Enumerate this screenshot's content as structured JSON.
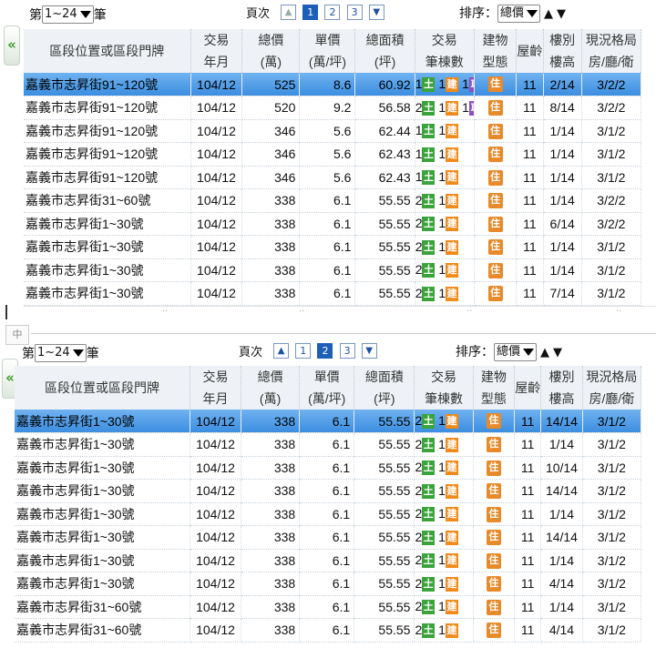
{
  "colors": {
    "selected_row": "#4a9be8",
    "land_badge": "#3aa33a",
    "building_badge": "#f08a1a",
    "car_badge": "#8f4fc0",
    "type_badge": "#e8892a"
  },
  "panels": [
    {
      "count_prefix": "第",
      "count_select": "1~24",
      "count_suffix": "筆",
      "pager_label": "頁次",
      "pages": [
        "1",
        "2",
        "3"
      ],
      "active_page": "1",
      "sort_label": "排序：",
      "sort_value": "總價",
      "headers": {
        "addr": "區段位置或區段門牌",
        "date": [
          "交易",
          "年月"
        ],
        "price": [
          "總價",
          "(萬)"
        ],
        "unit": [
          "單價",
          "(萬/坪)"
        ],
        "area": [
          "總面積",
          "(坪)"
        ],
        "deal": [
          "交易",
          "筆棟數"
        ],
        "btype": [
          "建物",
          "型態"
        ],
        "age": "屋齡",
        "floor": [
          "樓別",
          "樓高"
        ],
        "layout": [
          "現況格局",
          "房/廳/衛"
        ]
      },
      "rows": [
        {
          "addr": "嘉義市志昇街91~120號",
          "date": "104/12",
          "price": "525",
          "unit": "8.6",
          "area": "60.92",
          "land": "1",
          "bld": "1",
          "car": "1",
          "type": "住",
          "age": "11",
          "floor": "2/14",
          "layout": "3/2/2",
          "selected": true
        },
        {
          "addr": "嘉義市志昇街91~120號",
          "date": "104/12",
          "price": "520",
          "unit": "9.2",
          "area": "56.58",
          "land": "2",
          "bld": "1",
          "car": "1",
          "type": "住",
          "age": "11",
          "floor": "8/14",
          "layout": "3/2/2"
        },
        {
          "addr": "嘉義市志昇街91~120號",
          "date": "104/12",
          "price": "346",
          "unit": "5.6",
          "area": "62.44",
          "land": "1",
          "bld": "1",
          "car": "",
          "type": "住",
          "age": "11",
          "floor": "1/14",
          "layout": "3/1/2"
        },
        {
          "addr": "嘉義市志昇街91~120號",
          "date": "104/12",
          "price": "346",
          "unit": "5.6",
          "area": "62.43",
          "land": "1",
          "bld": "1",
          "car": "",
          "type": "住",
          "age": "11",
          "floor": "1/14",
          "layout": "3/1/2"
        },
        {
          "addr": "嘉義市志昇街91~120號",
          "date": "104/12",
          "price": "346",
          "unit": "5.6",
          "area": "62.43",
          "land": "1",
          "bld": "1",
          "car": "",
          "type": "住",
          "age": "11",
          "floor": "1/14",
          "layout": "3/1/2"
        },
        {
          "addr": "嘉義市志昇街31~60號",
          "date": "104/12",
          "price": "338",
          "unit": "6.1",
          "area": "55.55",
          "land": "2",
          "bld": "1",
          "car": "",
          "type": "住",
          "age": "11",
          "floor": "1/14",
          "layout": "3/2/2"
        },
        {
          "addr": "嘉義市志昇街1~30號",
          "date": "104/12",
          "price": "338",
          "unit": "6.1",
          "area": "55.55",
          "land": "2",
          "bld": "1",
          "car": "",
          "type": "住",
          "age": "11",
          "floor": "6/14",
          "layout": "3/2/2"
        },
        {
          "addr": "嘉義市志昇街1~30號",
          "date": "104/12",
          "price": "338",
          "unit": "6.1",
          "area": "55.55",
          "land": "2",
          "bld": "1",
          "car": "",
          "type": "住",
          "age": "11",
          "floor": "1/14",
          "layout": "3/1/2"
        },
        {
          "addr": "嘉義市志昇街1~30號",
          "date": "104/12",
          "price": "338",
          "unit": "6.1",
          "area": "55.55",
          "land": "2",
          "bld": "1",
          "car": "",
          "type": "住",
          "age": "11",
          "floor": "1/14",
          "layout": "3/1/2"
        },
        {
          "addr": "嘉義市志昇街1~30號",
          "date": "104/12",
          "price": "338",
          "unit": "6.1",
          "area": "55.55",
          "land": "2",
          "bld": "1",
          "car": "",
          "type": "住",
          "age": "11",
          "floor": "7/14",
          "layout": "3/1/2"
        }
      ]
    },
    {
      "count_prefix": "第",
      "count_select": "1~24",
      "count_suffix": "筆",
      "pager_label": "頁次",
      "pages": [
        "1",
        "2",
        "3"
      ],
      "active_page": "2",
      "sort_label": "排序：",
      "sort_value": "總價",
      "headers": {
        "addr": "區段位置或區段門牌",
        "date": [
          "交易",
          "年月"
        ],
        "price": [
          "總價",
          "(萬)"
        ],
        "unit": [
          "單價",
          "(萬/坪)"
        ],
        "area": [
          "總面積",
          "(坪)"
        ],
        "deal": [
          "交易",
          "筆棟數"
        ],
        "btype": [
          "建物",
          "型態"
        ],
        "age": "屋齡",
        "floor": [
          "樓別",
          "樓高"
        ],
        "layout": [
          "現況格局",
          "房/廳/衛"
        ]
      },
      "rows": [
        {
          "addr": "嘉義市志昇街1~30號",
          "date": "104/12",
          "price": "338",
          "unit": "6.1",
          "area": "55.55",
          "land": "2",
          "bld": "1",
          "car": "",
          "type": "住",
          "age": "11",
          "floor": "14/14",
          "layout": "3/1/2",
          "selected": true
        },
        {
          "addr": "嘉義市志昇街1~30號",
          "date": "104/12",
          "price": "338",
          "unit": "6.1",
          "area": "55.55",
          "land": "2",
          "bld": "1",
          "car": "",
          "type": "住",
          "age": "11",
          "floor": "1/14",
          "layout": "3/1/2"
        },
        {
          "addr": "嘉義市志昇街1~30號",
          "date": "104/12",
          "price": "338",
          "unit": "6.1",
          "area": "55.55",
          "land": "2",
          "bld": "1",
          "car": "",
          "type": "住",
          "age": "11",
          "floor": "10/14",
          "layout": "3/1/2"
        },
        {
          "addr": "嘉義市志昇街1~30號",
          "date": "104/12",
          "price": "338",
          "unit": "6.1",
          "area": "55.55",
          "land": "2",
          "bld": "1",
          "car": "",
          "type": "住",
          "age": "11",
          "floor": "14/14",
          "layout": "3/1/2"
        },
        {
          "addr": "嘉義市志昇街1~30號",
          "date": "104/12",
          "price": "338",
          "unit": "6.1",
          "area": "55.55",
          "land": "2",
          "bld": "1",
          "car": "",
          "type": "住",
          "age": "11",
          "floor": "1/14",
          "layout": "3/1/2"
        },
        {
          "addr": "嘉義市志昇街1~30號",
          "date": "104/12",
          "price": "338",
          "unit": "6.1",
          "area": "55.55",
          "land": "2",
          "bld": "1",
          "car": "",
          "type": "住",
          "age": "11",
          "floor": "14/14",
          "layout": "3/1/2"
        },
        {
          "addr": "嘉義市志昇街1~30號",
          "date": "104/12",
          "price": "338",
          "unit": "6.1",
          "area": "55.55",
          "land": "2",
          "bld": "1",
          "car": "",
          "type": "住",
          "age": "11",
          "floor": "1/14",
          "layout": "3/1/2"
        },
        {
          "addr": "嘉義市志昇街1~30號",
          "date": "104/12",
          "price": "338",
          "unit": "6.1",
          "area": "55.55",
          "land": "2",
          "bld": "1",
          "car": "",
          "type": "住",
          "age": "11",
          "floor": "4/14",
          "layout": "3/1/2"
        },
        {
          "addr": "嘉義市志昇街31~60號",
          "date": "104/12",
          "price": "338",
          "unit": "6.1",
          "area": "55.55",
          "land": "2",
          "bld": "1",
          "car": "",
          "type": "住",
          "age": "11",
          "floor": "1/14",
          "layout": "3/1/2"
        },
        {
          "addr": "嘉義市志昇街31~60號",
          "date": "104/12",
          "price": "338",
          "unit": "6.1",
          "area": "55.55",
          "land": "2",
          "bld": "1",
          "car": "",
          "type": "住",
          "age": "11",
          "floor": "4/14",
          "layout": "3/1/2"
        }
      ]
    }
  ],
  "mid_button": "中",
  "icons": {
    "collapse": "double-chevron-left-icon",
    "prev": "triangle-up-icon",
    "next": "triangle-down-icon",
    "sort_asc": "sort-up-icon",
    "sort_desc": "sort-down-icon"
  }
}
